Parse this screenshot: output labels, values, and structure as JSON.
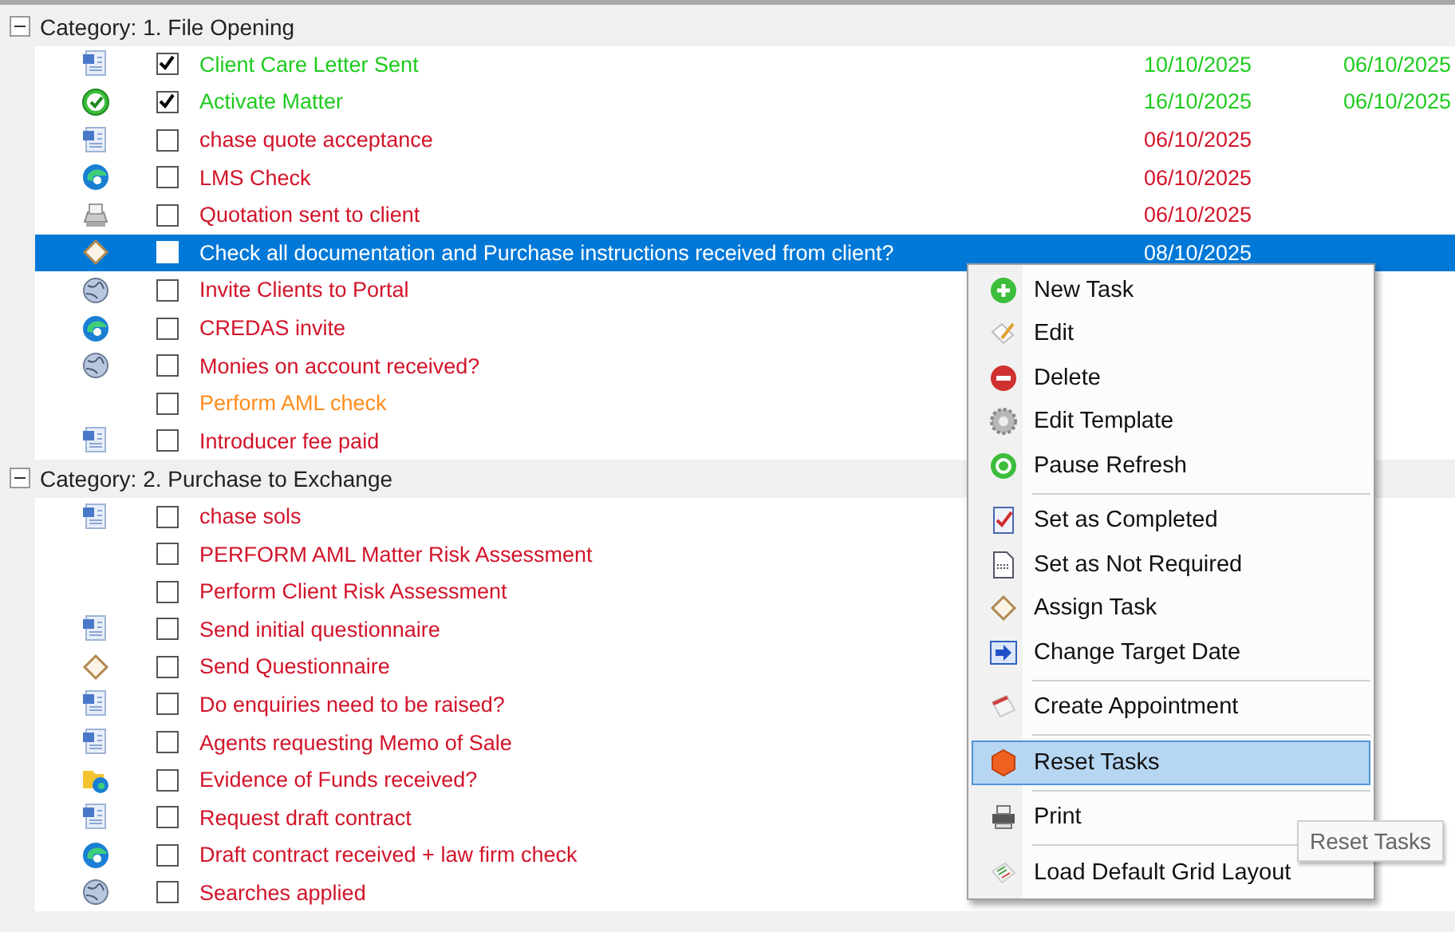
{
  "categories": [
    {
      "title": "Category: 1. File Opening",
      "expanded": true,
      "tasks": [
        {
          "kind": "document",
          "checked": true,
          "selected": false,
          "label": "Client Care Letter Sent",
          "color": "#1ecb1e",
          "date_1": "10/10/2025",
          "date_2": "06/10/2025"
        },
        {
          "kind": "check",
          "checked": true,
          "selected": false,
          "label": "Activate Matter",
          "color": "#1ecb1e",
          "date_1": "16/10/2025",
          "date_2": "06/10/2025"
        },
        {
          "kind": "document",
          "checked": false,
          "selected": false,
          "label": "chase quote acceptance",
          "color": "#d2142a",
          "date_1": "06/10/2025"
        },
        {
          "kind": "browser",
          "checked": false,
          "selected": false,
          "label": "LMS Check",
          "color": "#d2142a",
          "date_1": "06/10/2025"
        },
        {
          "kind": "scanner",
          "checked": false,
          "selected": false,
          "label": "Quotation sent to client",
          "color": "#d2142a",
          "date_1": "06/10/2025"
        },
        {
          "kind": "tag",
          "checked": false,
          "selected": true,
          "label": "Check all documentation and Purchase instructions received from client?",
          "date_1": "08/10/2025"
        },
        {
          "kind": "globe",
          "checked": false,
          "selected": false,
          "label": "Invite Clients to Portal",
          "color": "#d2142a"
        },
        {
          "kind": "browser",
          "checked": false,
          "selected": false,
          "label": "CREDAS invite",
          "color": "#d2142a"
        },
        {
          "kind": "globe",
          "checked": false,
          "selected": false,
          "label": "Monies on account received?",
          "color": "#d2142a"
        },
        {
          "kind": "plain",
          "checked": false,
          "selected": false,
          "label": "Perform AML check",
          "color": "#ff8c1a"
        },
        {
          "kind": "document",
          "checked": false,
          "selected": false,
          "label": "Introducer fee paid",
          "color": "#d2142a"
        }
      ]
    },
    {
      "title": "Category: 2. Purchase to Exchange",
      "expanded": true,
      "tasks": [
        {
          "kind": "document",
          "checked": false,
          "selected": false,
          "label": "chase sols",
          "color": "#d2142a"
        },
        {
          "kind": "plain",
          "checked": false,
          "selected": false,
          "label": "PERFORM AML Matter Risk Assessment",
          "color": "#d2142a"
        },
        {
          "kind": "plain",
          "checked": false,
          "selected": false,
          "label": "Perform Client Risk Assessment",
          "color": "#d2142a"
        },
        {
          "kind": "document",
          "checked": false,
          "selected": false,
          "label": "Send initial questionnaire",
          "color": "#d2142a"
        },
        {
          "kind": "tag",
          "checked": false,
          "selected": false,
          "label": "Send Questionnaire",
          "color": "#d2142a"
        },
        {
          "kind": "document",
          "checked": false,
          "selected": false,
          "label": "Do enquiries need to be raised?",
          "color": "#d2142a"
        },
        {
          "kind": "document",
          "checked": false,
          "selected": false,
          "label": "Agents requesting Memo of Sale",
          "color": "#d2142a"
        },
        {
          "kind": "folder",
          "checked": false,
          "selected": false,
          "label": "Evidence of Funds received?",
          "color": "#d2142a"
        },
        {
          "kind": "document",
          "checked": false,
          "selected": false,
          "label": "Request draft contract",
          "color": "#d2142a"
        },
        {
          "kind": "browser",
          "checked": false,
          "selected": false,
          "label": "Draft contract received + law firm check",
          "color": "#d2142a"
        },
        {
          "kind": "globe",
          "checked": false,
          "selected": false,
          "label": "Searches applied",
          "color": "#d2142a"
        }
      ]
    }
  ],
  "context_menu": {
    "groups": [
      [
        {
          "kind": "plus",
          "label": "New Task",
          "selected": false
        },
        {
          "kind": "pencil",
          "label": "Edit",
          "selected": false
        },
        {
          "kind": "minus",
          "label": "Delete",
          "selected": false
        },
        {
          "kind": "gear",
          "label": "Edit Template",
          "selected": false
        },
        {
          "kind": "refresh",
          "label": "Pause Refresh",
          "selected": false
        }
      ],
      [
        {
          "kind": "checklist",
          "label": "Set as Completed",
          "selected": false
        },
        {
          "kind": "page",
          "label": "Set as Not Required",
          "selected": false
        },
        {
          "kind": "tag",
          "label": "Assign Task",
          "selected": false
        },
        {
          "kind": "arrow",
          "label": "Change Target Date",
          "selected": false
        }
      ],
      [
        {
          "kind": "calendar",
          "label": "Create Appointment",
          "selected": false
        }
      ],
      [
        {
          "kind": "hexagon",
          "label": "Reset Tasks",
          "selected": true
        }
      ],
      [
        {
          "kind": "printer",
          "label": "Print",
          "selected": false
        }
      ],
      [
        {
          "kind": "layout",
          "label": "Load Default Grid Layout",
          "selected": false
        }
      ]
    ]
  },
  "tooltip": "Reset Tasks"
}
